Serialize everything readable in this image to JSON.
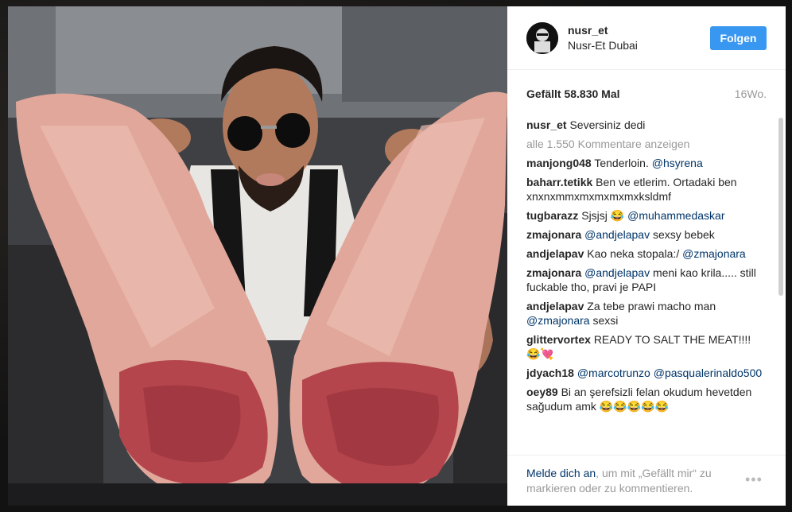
{
  "post": {
    "username": "nusr_et",
    "location": "Nusr-Et Dubai",
    "follow_label": "Folgen",
    "likes_label": "Gefällt 58.830 Mal",
    "age": "16Wo.",
    "caption_user": "nusr_et",
    "caption_text": "Seversiniz dedi",
    "view_all_comments": "alle 1.550 Kommentare anzeigen"
  },
  "comments": [
    {
      "user": "manjong048",
      "text": "Tenderloin.",
      "mention": "@hsyrena",
      "after": ""
    },
    {
      "user": "baharr.tetikk",
      "text": "Ben ve etlerim. Ortadaki ben xnxnxmmxmxmxmxmxksldmf",
      "mention": "",
      "after": ""
    },
    {
      "user": "tugbarazz",
      "text": "Sjsjsj",
      "emoji": "😂",
      "mention": "@muhammedaskar",
      "after": ""
    },
    {
      "user": "zmajonara",
      "text": "",
      "mention": "@andjelapav",
      "after": "sexsy bebek"
    },
    {
      "user": "andjelapav",
      "text": "Kao neka stopala:/",
      "mention": "@zmajonara",
      "after": ""
    },
    {
      "user": "zmajonara",
      "text": "",
      "mention": "@andjelapav",
      "after": "meni kao krila..... still fuckable tho, pravi je PAPI"
    },
    {
      "user": "andjelapav",
      "text": "Za tebe prawi macho man",
      "mention": "@zmajonara",
      "after": "sexsi"
    },
    {
      "user": "glittervortex",
      "text": "READY TO SALT THE MEAT!!!!",
      "emoji": "😂💘",
      "mention": "",
      "after": ""
    },
    {
      "user": "jdyach18",
      "text": "",
      "mention": "@marcotrunzo @pasqualerinaldo500",
      "after": ""
    },
    {
      "user": "oey89",
      "text": "Bi an şerefsizli felan okudum hevetden sağudum amk",
      "emoji": "😂😂😂😂😂",
      "mention": "",
      "after": ""
    }
  ],
  "footer": {
    "login_link": "Melde dich an",
    "login_text": ", um mit „Gefällt mir“ zu markieren oder zu kommentieren.",
    "more_icon": "more-options-icon"
  },
  "colors": {
    "follow_button": "#3897f0",
    "mention": "#003569",
    "muted": "#999999"
  }
}
